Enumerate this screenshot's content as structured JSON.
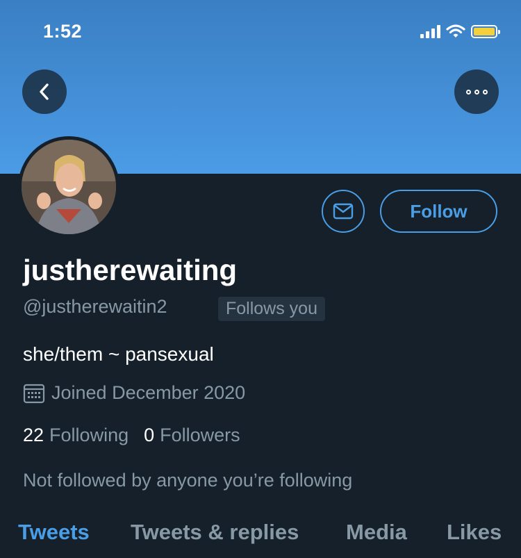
{
  "status_bar": {
    "time": "1:52",
    "icons": [
      "cellular-signal-icon",
      "wifi-icon",
      "battery-icon"
    ],
    "battery_color": "#f4d03f"
  },
  "header": {
    "banner_color": "#4b9be6",
    "back_icon": "chevron-left-icon",
    "more_icon": "more-options-icon"
  },
  "profile": {
    "display_name": "justherewaiting",
    "handle": "@justherewaitin2",
    "follows_you_badge": "Follows you",
    "bio": "she/them ~ pansexual",
    "joined": "Joined December 2020",
    "following_count": "22",
    "following_label": "Following",
    "followers_count": "0",
    "followers_label": "Followers",
    "mutuals_note": "Not followed by anyone you’re following"
  },
  "actions": {
    "message_icon": "mail-icon",
    "follow_label": "Follow",
    "accent_color": "#4a9ee6"
  },
  "tabs": [
    {
      "label": "Tweets",
      "active": true
    },
    {
      "label": "Tweets & replies",
      "active": false
    },
    {
      "label": "Media",
      "active": false
    },
    {
      "label": "Likes",
      "active": false
    }
  ]
}
